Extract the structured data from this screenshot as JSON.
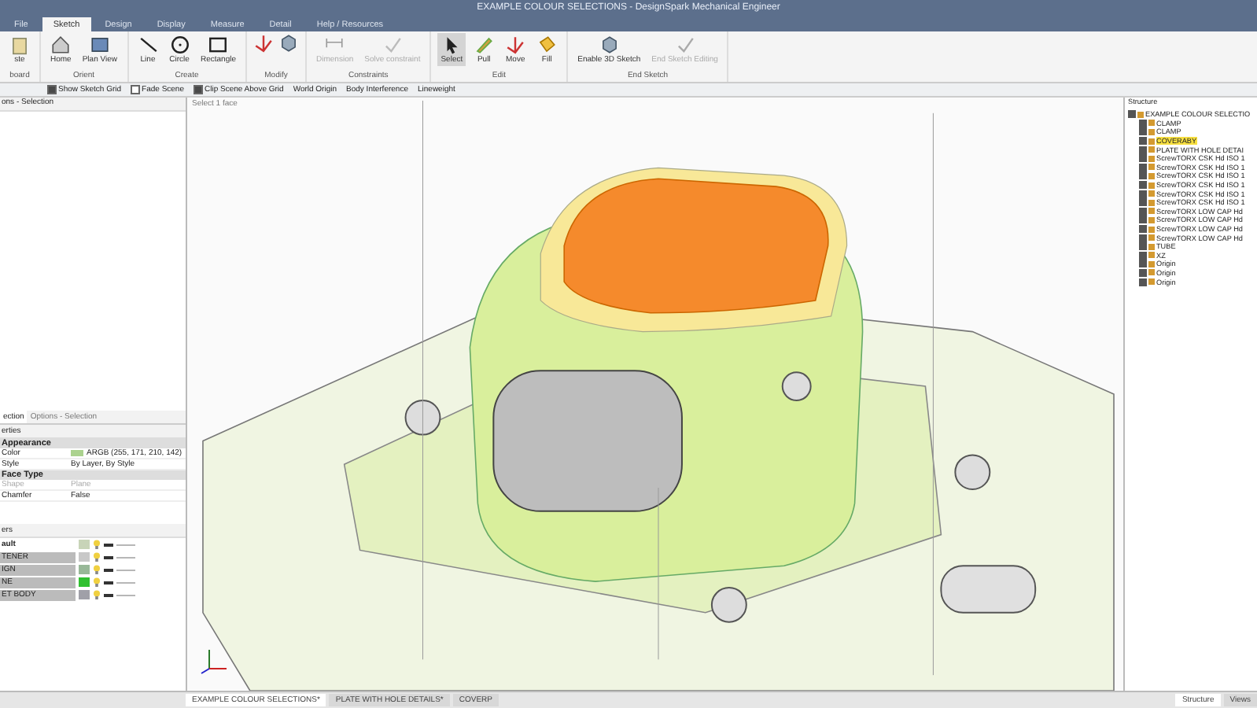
{
  "window": {
    "title": "EXAMPLE COLOUR SELECTIONS - DesignSpark Mechanical Engineer"
  },
  "tabs": [
    {
      "label": "File",
      "selected": false
    },
    {
      "label": "Sketch",
      "selected": true
    },
    {
      "label": "Design",
      "selected": false
    },
    {
      "label": "Display",
      "selected": false
    },
    {
      "label": "Measure",
      "selected": false
    },
    {
      "label": "Detail",
      "selected": false
    },
    {
      "label": "Help / Resources",
      "selected": false
    }
  ],
  "ribbon": [
    {
      "label": "board",
      "tools": [
        {
          "label": "ste",
          "selected": false,
          "disabled": false
        }
      ]
    },
    {
      "label": "Orient",
      "tools": [
        {
          "label": "Home",
          "selected": false,
          "disabled": false
        },
        {
          "label": "Plan View",
          "selected": false,
          "disabled": false
        }
      ]
    },
    {
      "label": "Create",
      "tools": [
        {
          "label": "Line",
          "selected": false,
          "disabled": false
        },
        {
          "label": "Circle",
          "selected": false,
          "disabled": false
        },
        {
          "label": "Rectangle",
          "selected": false,
          "disabled": false
        }
      ]
    },
    {
      "label": "Modify"
    },
    {
      "label": "Constraints",
      "tools": [
        {
          "label": "Dimension",
          "selected": false,
          "disabled": true
        },
        {
          "label": "Solve constraint",
          "selected": false,
          "disabled": true
        }
      ]
    },
    {
      "label": "Edit",
      "tools": [
        {
          "label": "Select",
          "selected": true,
          "disabled": false
        },
        {
          "label": "Pull",
          "selected": false,
          "disabled": false
        },
        {
          "label": "Move",
          "selected": false,
          "disabled": false
        },
        {
          "label": "Fill",
          "selected": false,
          "disabled": false
        }
      ]
    },
    {
      "label": "End Sketch",
      "tools": [
        {
          "label": "Enable 3D Sketch",
          "selected": false,
          "disabled": false
        },
        {
          "label": "End Sketch Editing",
          "selected": false,
          "disabled": true
        }
      ]
    }
  ],
  "toolbar": [
    {
      "kind": "check",
      "label": "Show Sketch Grid",
      "checked": true
    },
    {
      "kind": "check",
      "label": "Fade Scene",
      "checked": false
    },
    {
      "kind": "check",
      "label": "Clip Scene Above Grid",
      "checked": true
    },
    {
      "kind": "text",
      "label": "World Origin"
    },
    {
      "kind": "text",
      "label": "Body Interference"
    },
    {
      "kind": "text",
      "label": "Lineweight"
    }
  ],
  "left_panel": {
    "title": "ons - Selection",
    "tabs": [
      {
        "label": "ection",
        "selected": true
      },
      {
        "label": "Options - Selection",
        "selected": false
      }
    ],
    "properties_title": "erties",
    "property_groups": [
      {
        "name": "Appearance",
        "rows": [
          {
            "name": "Color",
            "value": "ARGB (255, 171, 210, 142)",
            "color": "#abd28e",
            "disabled": false
          },
          {
            "name": "Style",
            "value": "By Layer, By Style",
            "disabled": false
          }
        ]
      },
      {
        "name": "Face Type",
        "rows": [
          {
            "name": "Shape",
            "value": "Plane",
            "disabled": true
          },
          {
            "name": "Chamfer",
            "value": "False",
            "disabled": false
          }
        ]
      }
    ],
    "layers_title": "ers",
    "layers": [
      {
        "name": "ault",
        "selected": true,
        "color": "#c8d4b8"
      },
      {
        "name": "TENER",
        "selected": false,
        "color": "#c8c8c8"
      },
      {
        "name": "IGN",
        "selected": false,
        "color": "#98b898"
      },
      {
        "name": "NE",
        "selected": false,
        "color": "#30c030"
      },
      {
        "name": "ET BODY",
        "selected": false,
        "color": "#a0a0a8"
      }
    ]
  },
  "viewport": {
    "hint": "Select 1 face"
  },
  "structure": {
    "title": "Structure",
    "tree": [
      {
        "label": "EXAMPLE COLOUR SELECTIO",
        "checked": true,
        "selected": false,
        "children": [
          {
            "label": "CLAMP",
            "checked": true,
            "selected": false
          },
          {
            "label": "CLAMP",
            "checked": true,
            "selected": false
          },
          {
            "label": "COVERABY",
            "checked": true,
            "selected": true
          },
          {
            "label": "PLATE WITH HOLE DETAI",
            "checked": true,
            "selected": false
          },
          {
            "label": "ScrewTORX CSK Hd ISO 1",
            "checked": true,
            "selected": false
          },
          {
            "label": "ScrewTORX CSK Hd ISO 1",
            "checked": true,
            "selected": false
          },
          {
            "label": "ScrewTORX CSK Hd ISO 1",
            "checked": true,
            "selected": false
          },
          {
            "label": "ScrewTORX CSK Hd ISO 1",
            "checked": true,
            "selected": false
          },
          {
            "label": "ScrewTORX CSK Hd ISO 1",
            "checked": true,
            "selected": false
          },
          {
            "label": "ScrewTORX CSK Hd ISO 1",
            "checked": true,
            "selected": false
          },
          {
            "label": "ScrewTORX LOW CAP Hd",
            "checked": true,
            "selected": false
          },
          {
            "label": "ScrewTORX LOW CAP Hd",
            "checked": true,
            "selected": false
          },
          {
            "label": "ScrewTORX LOW CAP Hd",
            "checked": true,
            "selected": false
          },
          {
            "label": "ScrewTORX LOW CAP Hd",
            "checked": true,
            "selected": false
          },
          {
            "label": "TUBE",
            "checked": true,
            "selected": false
          },
          {
            "label": "XZ",
            "checked": true,
            "selected": false
          },
          {
            "label": "Origin",
            "checked": true,
            "selected": false
          },
          {
            "label": "Origin",
            "checked": true,
            "selected": false
          },
          {
            "label": "Origin",
            "checked": true,
            "selected": false
          }
        ]
      }
    ]
  },
  "document_tabs": [
    {
      "label": "EXAMPLE COLOUR SELECTIONS*",
      "selected": true
    },
    {
      "label": "PLATE WITH HOLE DETAILS*",
      "selected": false
    },
    {
      "label": "COVERP",
      "selected": false
    }
  ],
  "panel_tabs": [
    {
      "label": "Structure",
      "selected": true
    },
    {
      "label": "Views",
      "selected": false
    }
  ]
}
